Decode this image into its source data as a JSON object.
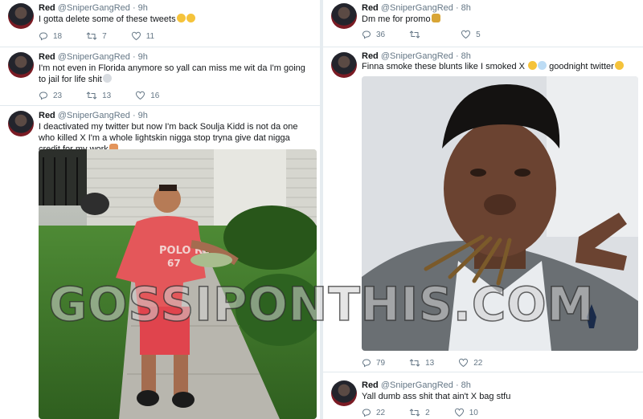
{
  "watermark": "GOSSIPONTHIS.COM",
  "tweets": [
    {
      "name": "Red",
      "handle": "@SniperGangRed · 9h",
      "text": "I gotta delete some of these tweets",
      "emoji": [
        "face-with-tears-of-joy",
        "face-with-tears-of-joy"
      ],
      "replies": "18",
      "retweets": "7",
      "likes": "11"
    },
    {
      "name": "Red",
      "handle": "@SniperGangRed · 9h",
      "text": "I'm not even in Florida anymore so yall can miss me wit da I'm going to jail for life shit",
      "emoji": [
        "skull"
      ],
      "replies": "23",
      "retweets": "13",
      "likes": "16"
    },
    {
      "name": "Red",
      "handle": "@SniperGangRed · 9h",
      "text": "I deactivated my twitter but now I'm back Soulja Kidd is not da one who killed X I'm a whole lightskin nigga stop tryna give dat nigga credit for my work",
      "emoji": [
        "person-gesturing"
      ],
      "image": "photo-man-red-shirt-holding-cash"
    },
    {
      "name": "Red",
      "handle": "@SniperGangRed · 8h",
      "text": "Dm me for promo",
      "emoji": [
        "money-bag"
      ],
      "replies": "36",
      "retweets": "",
      "likes": "5"
    },
    {
      "name": "Red",
      "handle": "@SniperGangRed · 8h",
      "text": "Finna smoke these blunts like I smoked X",
      "text_after": "goodnight twitter",
      "emoji": [
        "grinning-face",
        "dash"
      ],
      "emoji_end": [
        "face-blowing-kiss"
      ],
      "image": "photo-selfie-with-blunts",
      "replies": "79",
      "retweets": "13",
      "likes": "22"
    },
    {
      "name": "Red",
      "handle": "@SniperGangRed · 8h",
      "text": "Yall dumb ass shit that ain't X bag stfu",
      "replies": "22",
      "retweets": "2",
      "likes": "10"
    }
  ],
  "colors": {
    "background": "#e6ecf0",
    "text": "#14171a",
    "muted": "#657786"
  }
}
